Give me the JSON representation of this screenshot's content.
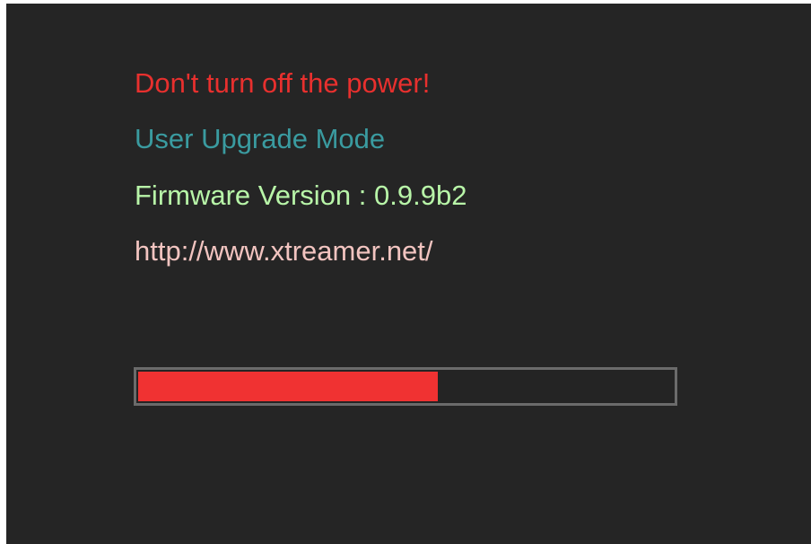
{
  "screen": {
    "warning_text": "Don't turn off the power!",
    "mode_text": "User Upgrade Mode",
    "firmware_text": "Firmware Version : 0.9.9b2",
    "url_text": "http://www.xtreamer.net/"
  },
  "progress": {
    "fraction": 0.56
  },
  "colors": {
    "background": "#252525",
    "warning": "#e8302e",
    "mode": "#3a9ba0",
    "firmware": "#b8f5a8",
    "url": "#f2c4c0",
    "progress_fill": "#f03232",
    "progress_border": "#6b6b6b"
  }
}
